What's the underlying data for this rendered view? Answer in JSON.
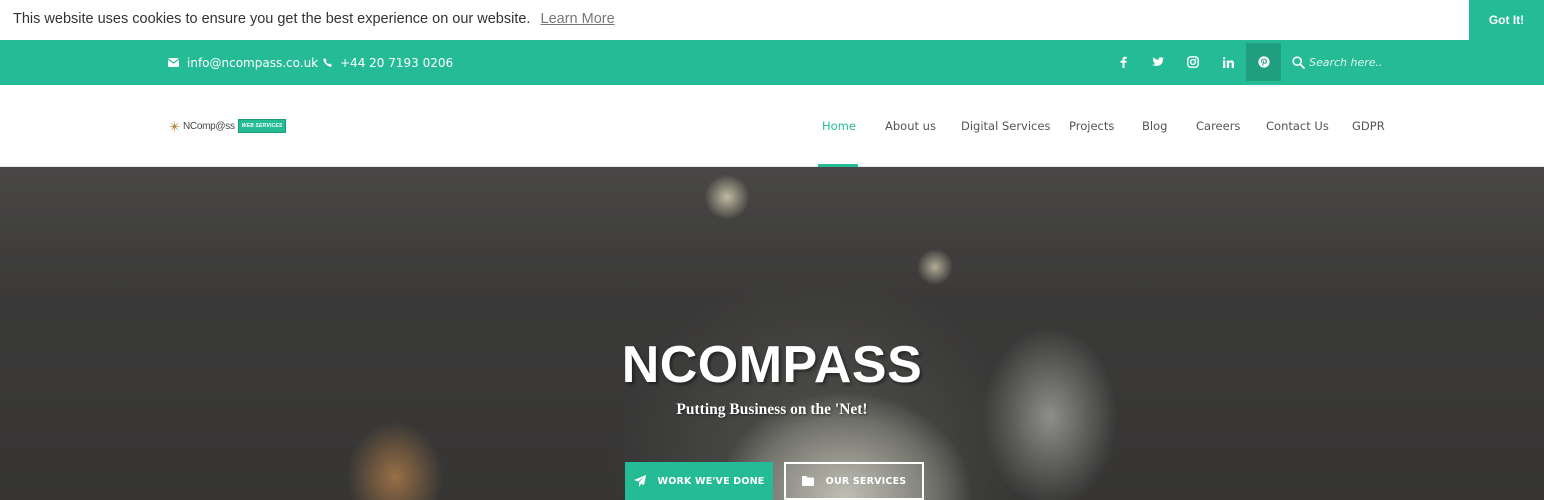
{
  "cookie": {
    "message": "This website uses cookies to ensure you get the best experience on our website.",
    "learn_more": "Learn More",
    "accept": "Got It!"
  },
  "topbar": {
    "email": "info@ncompass.co.uk",
    "phone": "+44 20 7193 0206",
    "social": [
      "facebook",
      "twitter",
      "instagram",
      "linkedin",
      "pinterest"
    ],
    "search_placeholder": "Search here.."
  },
  "header": {
    "logo_text": "NComp@ss",
    "logo_badge": "WEB SERVICES",
    "nav": [
      {
        "label": "Home",
        "active": true
      },
      {
        "label": "About us"
      },
      {
        "label": "Digital Services"
      },
      {
        "label": "Projects"
      },
      {
        "label": "Blog"
      },
      {
        "label": "Careers"
      },
      {
        "label": "Contact Us"
      },
      {
        "label": "GDPR"
      }
    ]
  },
  "hero": {
    "title": "NCOMPASS",
    "tagline": "Putting Business on the 'Net!",
    "btn_primary": "WORK WE'VE DONE",
    "btn_secondary": "OUR SERVICES"
  },
  "colors": {
    "accent": "#26bb97",
    "accent_dark": "#1f9f80"
  }
}
